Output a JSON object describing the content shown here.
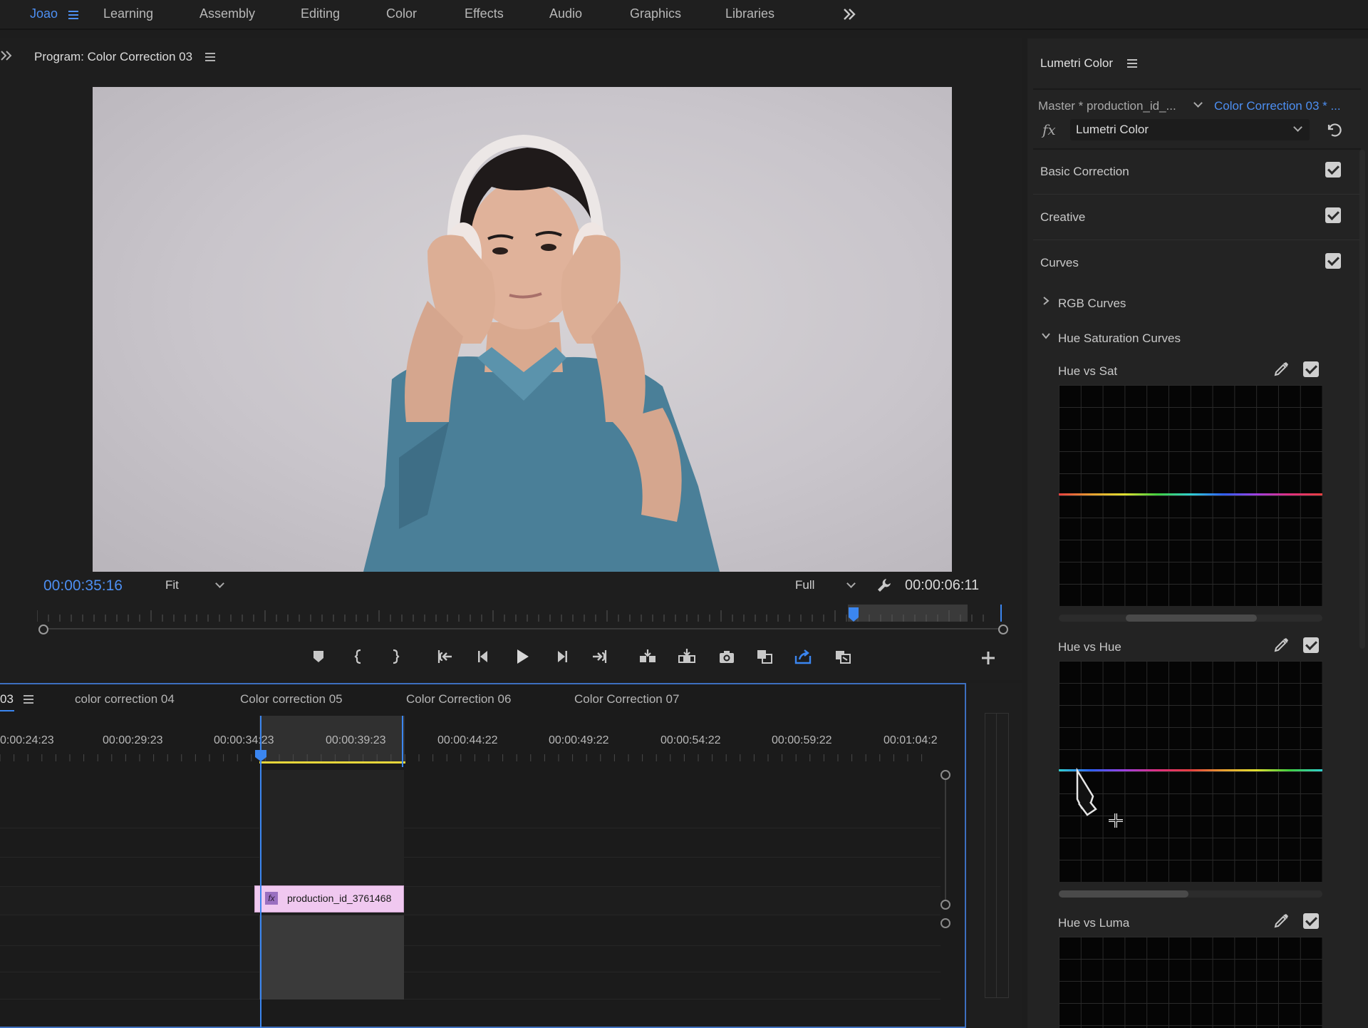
{
  "workspaces": {
    "tabs": [
      {
        "label": "Joao"
      },
      {
        "label": "Learning"
      },
      {
        "label": "Assembly"
      },
      {
        "label": "Editing"
      },
      {
        "label": "Color"
      },
      {
        "label": "Effects"
      },
      {
        "label": "Audio"
      },
      {
        "label": "Graphics"
      },
      {
        "label": "Libraries"
      }
    ],
    "more_icon": "double-chevron-right-icon"
  },
  "program": {
    "title": "Program: Color Correction 03",
    "current_timecode": "00:00:35:16",
    "zoom": "Fit",
    "resolution": "Full",
    "duration_timecode": "00:00:06:11"
  },
  "timeline": {
    "sequence_tab": "03",
    "tabs": [
      {
        "label": "color correction 04"
      },
      {
        "label": "Color correction 05"
      },
      {
        "label": "Color Correction 06"
      },
      {
        "label": "Color Correction 07"
      }
    ],
    "ruler": [
      {
        "label": "0:00:24:23"
      },
      {
        "label": "00:00:29:23"
      },
      {
        "label": "00:00:34:23"
      },
      {
        "label": "00:00:39:23"
      },
      {
        "label": "00:00:44:22"
      },
      {
        "label": "00:00:49:22"
      },
      {
        "label": "00:00:54:22"
      },
      {
        "label": "00:00:59:22"
      },
      {
        "label": "00:01:04:2"
      }
    ],
    "clip": {
      "fx": "fx",
      "name": "production_id_3761468"
    }
  },
  "lumetri": {
    "title": "Lumetri Color",
    "master_clip": "Master * production_id_...",
    "sequence_clip": "Color Correction 03 * ...",
    "effect_select": "Lumetri Color",
    "sections": [
      {
        "label": "Basic Correction",
        "enabled": true
      },
      {
        "label": "Creative",
        "enabled": true
      },
      {
        "label": "Curves",
        "enabled": true
      }
    ],
    "rgb_curves": "RGB Curves",
    "hue_sat_curves": "Hue Saturation Curves",
    "curves": [
      {
        "label": "Hue vs Sat",
        "enabled": true
      },
      {
        "label": "Hue vs Hue",
        "enabled": true
      },
      {
        "label": "Hue vs Luma",
        "enabled": true
      }
    ],
    "accent": "#4d8ff2"
  }
}
